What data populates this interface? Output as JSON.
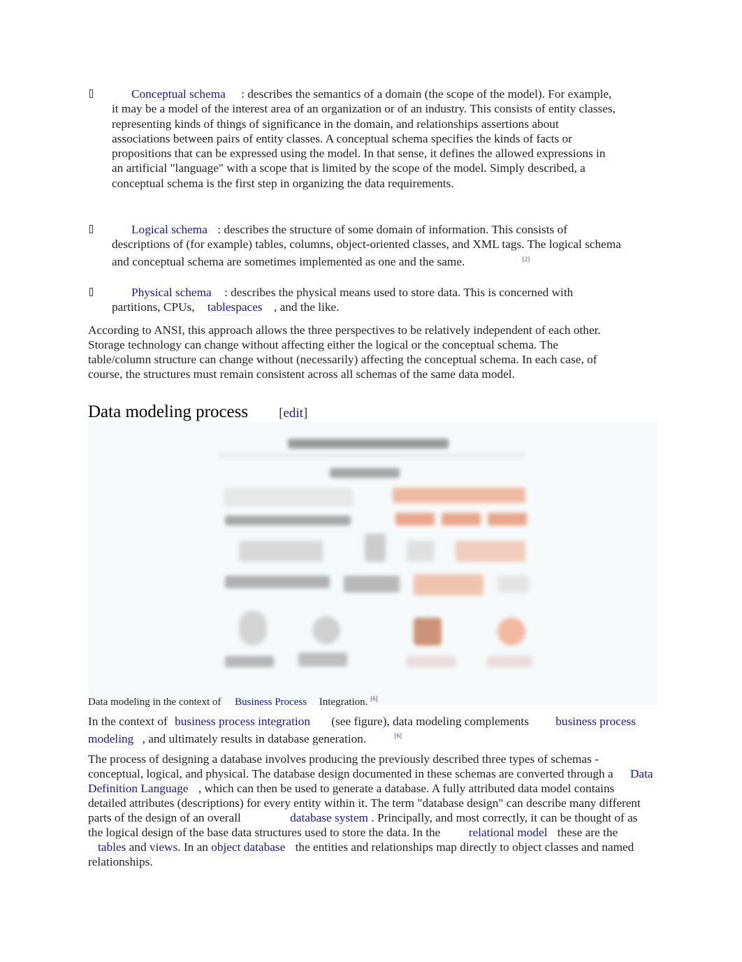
{
  "bullets": [
    {
      "link": "Conceptual schema",
      "text": ": describes the semantics of a domain (the scope of the model). For example, it may be a model of the interest area of an organization or of an industry. This consists of entity classes, representing kinds of things of significance in the domain, and relationships assertions about associations between pairs of entity classes. A conceptual schema specifies the kinds of facts or propositions that can be expressed using the model. In that sense, it defines the allowed expressions in an artificial \"language\" with a scope that is limited by the scope of the model. Simply described, a conceptual schema is the first step in organizing the data requirements."
    },
    {
      "link": "Logical schema",
      "text": ": describes the structure of some domain of information. This consists of descriptions of (for example) tables, columns, object-oriented classes, and XML tags. The logical schema and conceptual schema are sometimes implemented as one and the same.",
      "ref": "[2]"
    },
    {
      "link": "Physical schema",
      "text": ": describes the physical means used to store data. This is concerned with partitions, CPUs,",
      "link2": "tablespaces",
      "text2": ", and the like."
    }
  ],
  "ansi_paragraph": "According to ANSI, this approach allows the three perspectives to be relatively independent of each other. Storage technology can change without affecting either the logical or the conceptual schema. The table/column structure can change without (necessarily) affecting the conceptual schema. In each case, of course, the structures must remain consistent across all schemas of the same data model.",
  "section": {
    "title": "Data modeling process",
    "edit_open": "[",
    "edit_label": "edit",
    "edit_close": "]"
  },
  "figure": {
    "alt": "Business Model Integration diagram",
    "caption_pre": "Data modeling in the context of",
    "caption_link": "Business Process",
    "caption_post": "Integration.",
    "caption_ref": "[6]"
  },
  "para_bpi": {
    "pre": "In the context of",
    "link1": "business process integration",
    "mid": "(see figure), data modeling complements",
    "link2": "business process modeling",
    "post": ", and ultimately results in database generation.",
    "ref": "[6]"
  },
  "para_design": {
    "t1": "The process of designing a database involves producing the previously described three types of schemas - conceptual, logical, and physical. The database design documented in these schemas are converted through a",
    "l1": "Data Definition Language",
    "t2": ", which can then be used to generate a database. A fully attributed data model contains detailed attributes (descriptions) for every entity within it. The term \"database design\" can describe many different parts of the design of an overall",
    "l2": "database system",
    "t3": ". Principally, and most correctly, it can be thought of as the logical design of the base data structures used to store the data. In the",
    "l3": "relational model",
    "t4": "these are the",
    "l4": "tables",
    "t5": "and",
    "l5": "views",
    "t6": ". In an",
    "l6": "object database",
    "t7": "the entities and relationships map directly to object classes and named relationships."
  }
}
